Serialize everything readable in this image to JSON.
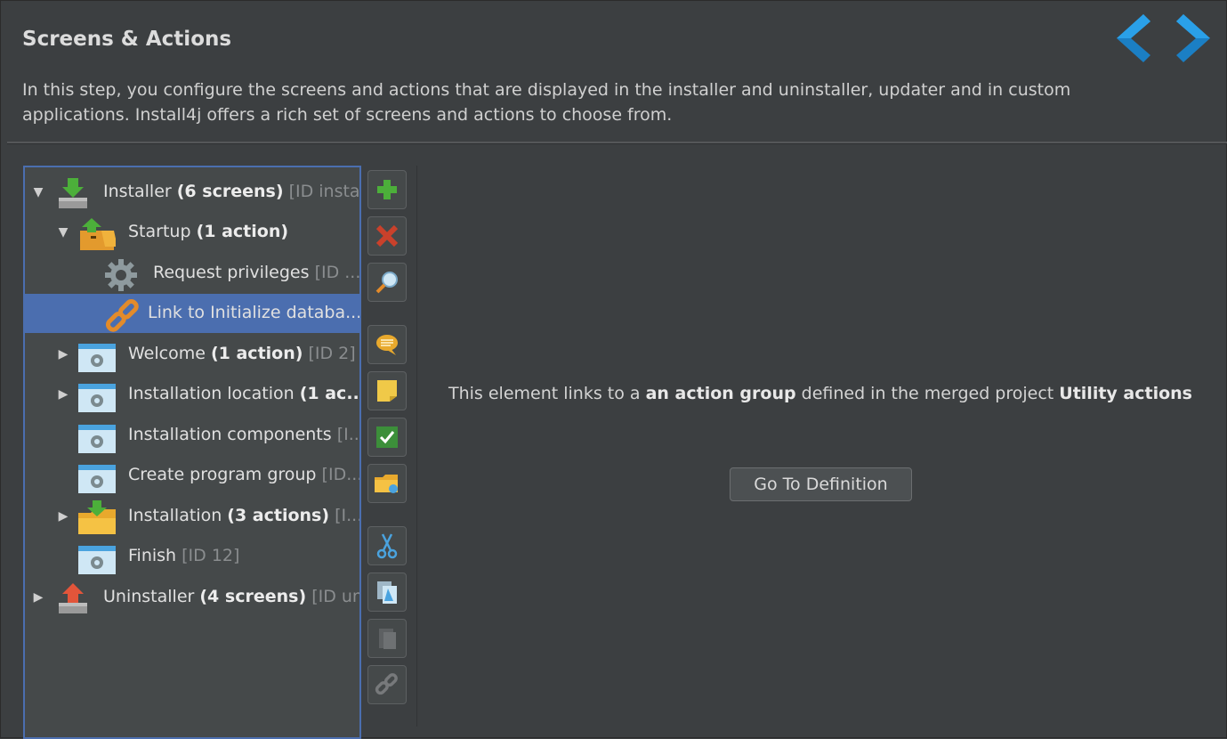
{
  "header": {
    "title": "Screens & Actions",
    "description": "In this step, you configure the screens and actions that are displayed in the installer and uninstaller, updater and in custom applications. Install4j offers a rich set of screens and actions to choose from."
  },
  "tree": [
    {
      "name": "Installer",
      "count": "(6 screens)",
      "id": "[ID instal..."
    },
    {
      "name": "Startup",
      "count": "(1 action)",
      "id": ""
    },
    {
      "name": "Request privileges",
      "count": "",
      "id": "[ID ..."
    },
    {
      "name": "Link to Initialize databa...",
      "count": "",
      "id": ""
    },
    {
      "name": "Welcome",
      "count": "(1 action)",
      "id": "[ID 2]"
    },
    {
      "name": "Installation location",
      "count": "(1 ac...",
      "id": ""
    },
    {
      "name": "Installation components",
      "count": "",
      "id": "[I..."
    },
    {
      "name": "Create program group",
      "count": "",
      "id": "[ID..."
    },
    {
      "name": "Installation",
      "count": "(3 actions)",
      "id": "[I..."
    },
    {
      "name": "Finish",
      "count": "",
      "id": "[ID 12]"
    },
    {
      "name": "Uninstaller",
      "count": "(4 screens)",
      "id": "[ID un..."
    }
  ],
  "detail": {
    "text_before": "This element links to a ",
    "bold1": "an action group",
    "text_middle": " defined in the merged project ",
    "bold2": "Utility actions",
    "goto_label": "Go To Definition"
  },
  "toolbar_icons": [
    "add-icon",
    "delete-icon",
    "search-icon",
    "comment-icon",
    "note-icon",
    "check-icon",
    "folder-link-icon",
    "cut-icon",
    "copy-icon",
    "paste-icon",
    "link-icon"
  ]
}
